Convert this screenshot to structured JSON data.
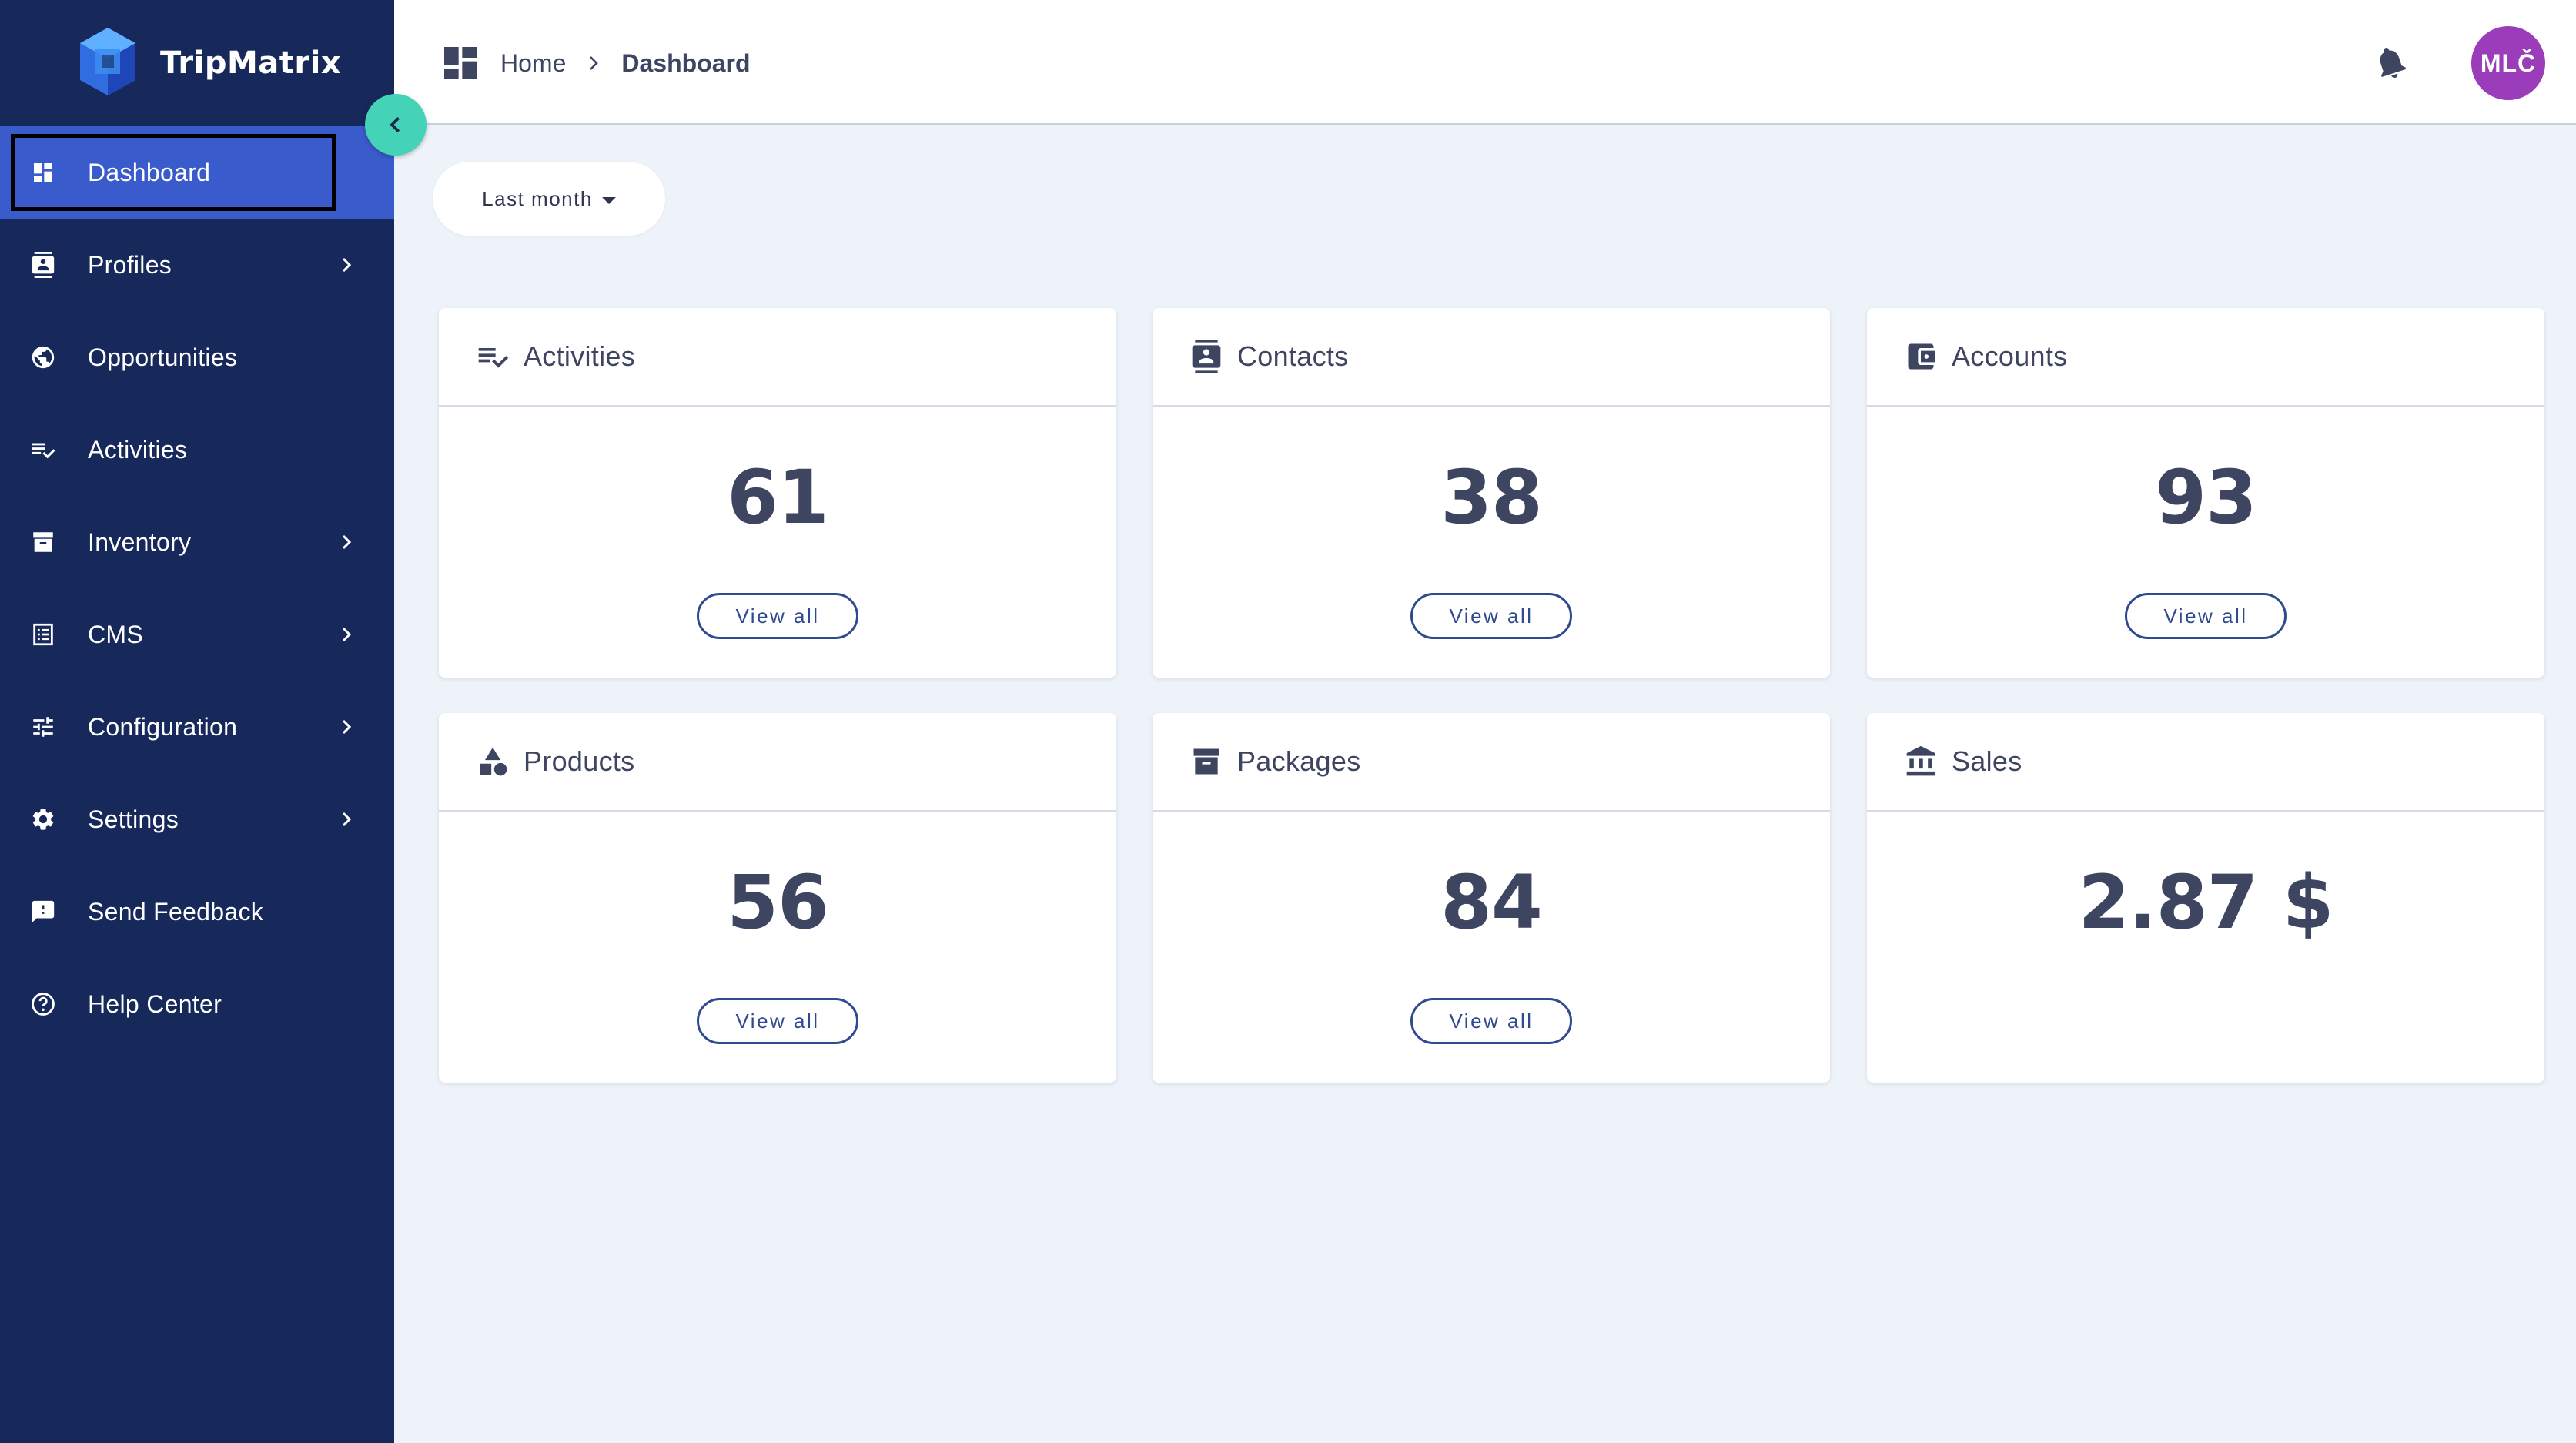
{
  "brand": {
    "name": "TripMatrix"
  },
  "sidebar": {
    "items": [
      {
        "label": "Dashboard",
        "icon": "dashboard-icon",
        "has_chevron": false,
        "active": true
      },
      {
        "label": "Profiles",
        "icon": "contacts-icon",
        "has_chevron": true
      },
      {
        "label": "Opportunities",
        "icon": "globe-icon",
        "has_chevron": false
      },
      {
        "label": "Activities",
        "icon": "checklist-icon",
        "has_chevron": false
      },
      {
        "label": "Inventory",
        "icon": "archive-icon",
        "has_chevron": true
      },
      {
        "label": "CMS",
        "icon": "list-icon",
        "has_chevron": true
      },
      {
        "label": "Configuration",
        "icon": "sliders-icon",
        "has_chevron": true
      },
      {
        "label": "Settings",
        "icon": "gear-icon",
        "has_chevron": true
      },
      {
        "label": "Send Feedback",
        "icon": "feedback-icon",
        "has_chevron": false
      },
      {
        "label": "Help Center",
        "icon": "help-icon",
        "has_chevron": false
      }
    ]
  },
  "header": {
    "breadcrumb": {
      "home": "Home",
      "current": "Dashboard"
    },
    "avatar_initials": "MLČ"
  },
  "filter": {
    "label": "Last month"
  },
  "cards": [
    {
      "title": "Activities",
      "value": "61",
      "button": "View all",
      "icon": "checklist-icon"
    },
    {
      "title": "Contacts",
      "value": "38",
      "button": "View all",
      "icon": "contacts-icon"
    },
    {
      "title": "Accounts",
      "value": "93",
      "button": "View all",
      "icon": "wallet-icon"
    },
    {
      "title": "Products",
      "value": "56",
      "button": "View all",
      "icon": "shapes-icon"
    },
    {
      "title": "Packages",
      "value": "84",
      "button": "View all",
      "icon": "archive-icon"
    },
    {
      "title": "Sales",
      "value": "2.87 $",
      "icon": "bank-icon"
    }
  ],
  "colors": {
    "sidebar_bg": "#17295a",
    "active_item": "#3a5bcc",
    "collapse_button": "#45d3b8",
    "avatar": "#9b3dbb",
    "page_bg": "#eef2f9",
    "button_border": "#304a92"
  }
}
